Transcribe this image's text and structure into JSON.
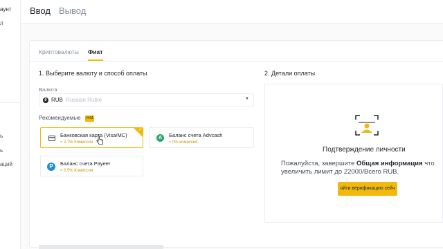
{
  "sidebar": {
    "items": [
      {
        "label": "аунт",
        "active": true
      },
      {
        "label": "л"
      },
      {
        "label": "ь"
      },
      {
        "label": "ь"
      },
      {
        "label": "аций"
      }
    ]
  },
  "header": {
    "tabs": [
      {
        "label": "Ввод",
        "active": true
      },
      {
        "label": "Вывод",
        "active": false
      }
    ]
  },
  "subtabs": [
    {
      "label": "Криптовалюты",
      "active": false
    },
    {
      "label": "Фиат",
      "active": true
    }
  ],
  "step1": {
    "title": "1. Выберите валюту и способ оплаты",
    "currency_label": "Валюта",
    "currency": {
      "code": "RUB",
      "name": "Russian Ruble",
      "icon": "ruble-icon"
    },
    "recommended_label": "Рекомендуемые",
    "hot_badge": "Hot",
    "methods": [
      {
        "title": "Банковская карта (Visa/MC)",
        "fee": "≈ 2.7% Комиссия",
        "icon": "card-icon",
        "selected": true
      },
      {
        "title": "Баланс счета Advcash",
        "fee": "≈ 0% комиссия",
        "icon": "advcash-icon",
        "selected": false
      },
      {
        "title": "Баланс счета Payeer",
        "fee": "≈ 0.5% Комиссия",
        "icon": "payeer-icon",
        "selected": false
      }
    ]
  },
  "step2": {
    "title": "2. Детали оплаты",
    "verify_title": "Подтверждение личности",
    "verify_text_prefix": "Пожалуйста, завершите ",
    "verify_text_bold": "Общая информация",
    "verify_text_suffix": " что",
    "verify_text_line2": "увеличить лимит до 22000/Всего RUB.",
    "verify_button": "ойти верификацию сейч",
    "icon": "face-scan-icon"
  },
  "colors": {
    "accent": "#f0b90b",
    "fee": "#c99400",
    "text": "#1e2329",
    "muted": "#848e9c"
  }
}
